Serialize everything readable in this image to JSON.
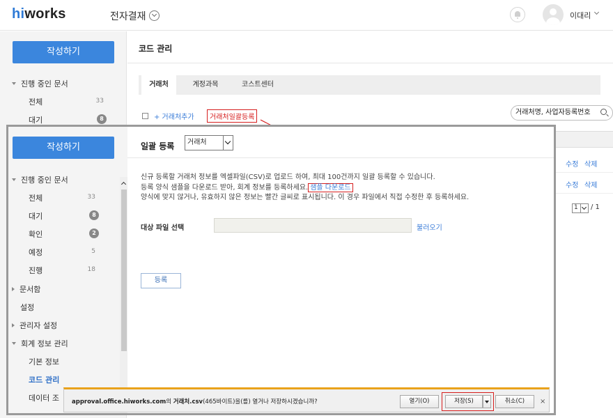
{
  "header": {
    "logo": {
      "accent": "hi",
      "rest": "works"
    },
    "app_title": "전자결재",
    "user_name": "이대리"
  },
  "sidebar": {
    "compose_label": "작성하기",
    "in_progress_section": "진행 중인 문서",
    "items": [
      {
        "label": "전체",
        "count": "33",
        "badge": false
      },
      {
        "label": "대기",
        "count": "8",
        "badge": true
      },
      {
        "label": "확인",
        "count": "2",
        "badge": true
      },
      {
        "label": "예정",
        "count": "5",
        "badge": false
      },
      {
        "label": "진행",
        "count": "18",
        "badge": false
      }
    ],
    "archive_section": "문서함",
    "settings": "설정",
    "admin_section": "관리자 설정",
    "accounting_section": "회계 정보 관리",
    "accounting_items": [
      "기본 정보",
      "코드 관리",
      "데이터 조"
    ]
  },
  "main": {
    "page_title": "코드 관리",
    "tabs": [
      "거래처",
      "계정과목",
      "코스트센터"
    ],
    "add_link": "+ 거래처추가",
    "bulk_link": "거래처일괄등록",
    "search_placeholder": "거래처명, 사업자등록번호",
    "row_edit": "수정",
    "row_delete": "삭제",
    "pager_current": "1",
    "pager_total": "/ 1"
  },
  "dialog": {
    "title": "일괄 등록",
    "type_select": "거래처",
    "desc_line1": "신규 등록할 거래처 정보를 엑셀파일(CSV)로 업로드 하여, 최대 100건까지 일괄 등록할 수 있습니다.",
    "desc_line2_prefix": "등록 양식 샘플을 다운로드 받아, 회계 정보를 등록하세요.",
    "sample_download": "샘플 다운로드",
    "desc_line3": "양식에 맞지 않거나, 유효하지 않은 정보는 빨간 글씨로 표시됩니다. 이 경우 파일에서 직접 수정한 후 등록하세요.",
    "file_label": "대상 파일 선택",
    "browse": "불러오기",
    "register": "등록"
  },
  "download_bar": {
    "site": "approval.office.hiworks.com",
    "mid1": "의 ",
    "filename": "거래처.csv",
    "rest": "(465바이트)을(를) 열거나 저장하시겠습니까?",
    "open": "열기(O)",
    "save": "저장(S)",
    "cancel": "취소(C)",
    "close": "×"
  },
  "colors": {
    "accent": "#3b86dd",
    "link": "#3b7dd8",
    "highlight": "#d61e1e",
    "dlbar_border": "#e9a21b"
  },
  "icons": [
    "chevron-circle-down-icon",
    "bell-icon",
    "avatar-icon",
    "chevron-down-icon",
    "search-icon",
    "close-icon"
  ]
}
